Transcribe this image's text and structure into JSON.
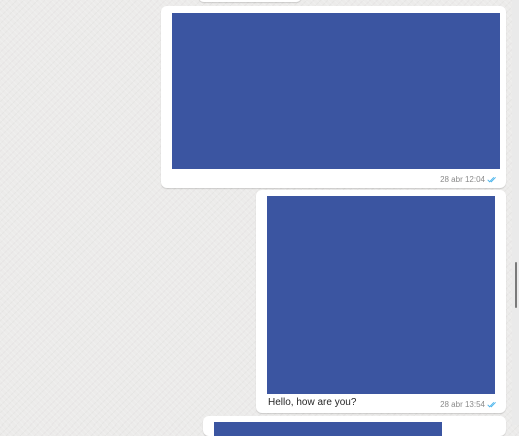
{
  "messages": [
    {
      "type": "image",
      "timestamp": "28 abr 12:04",
      "status": "read",
      "media_color": "#3b55a1"
    },
    {
      "type": "image",
      "caption": "Hello, how are you?",
      "timestamp": "28 abr 13:54",
      "status": "read",
      "media_color": "#3b55a1"
    }
  ],
  "colors": {
    "tick": "#4fb6ec",
    "chat_background": "#ecebea",
    "bubble": "#ffffff"
  }
}
